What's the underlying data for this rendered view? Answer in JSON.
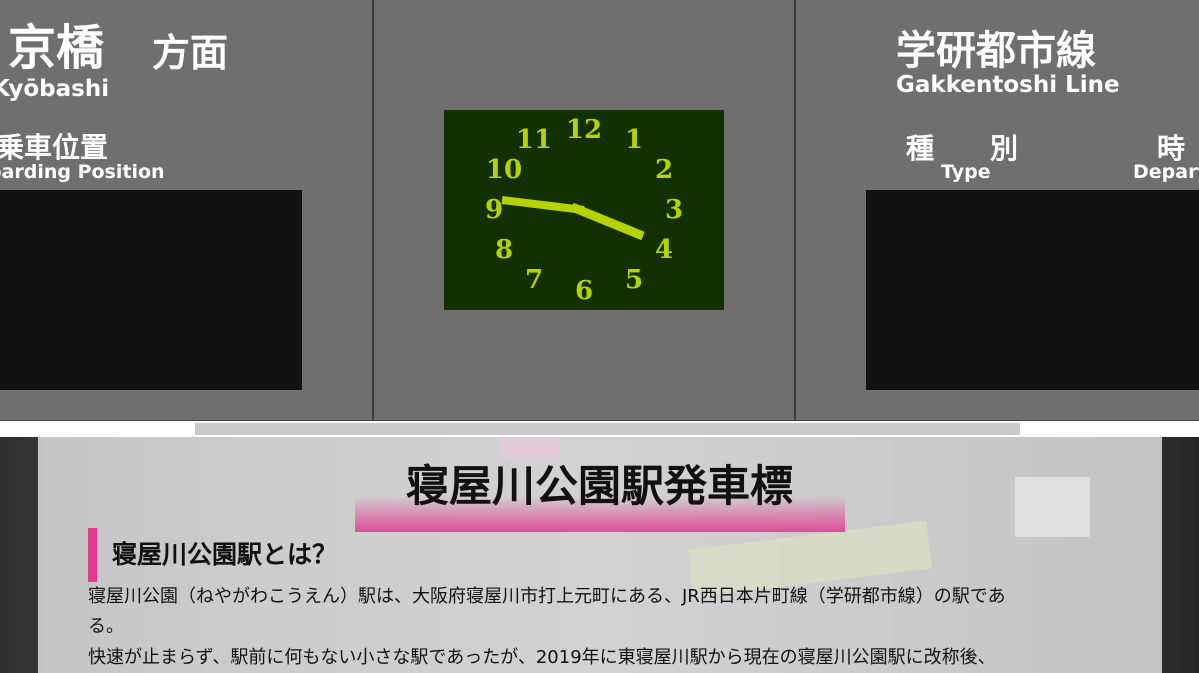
{
  "board": {
    "left": {
      "destination_jp": "京橋",
      "direction_jp": "方面",
      "destination_en": "Kyōbashi",
      "boarding_jp": "乗車位置",
      "boarding_en": "Boarding Position"
    },
    "right": {
      "line_jp": "学研都市線",
      "line_en": "Gakkentoshi Line",
      "type_jp": "種　　別",
      "type_en": "Type",
      "time_jp": "時",
      "time_en": "Depart"
    },
    "clock": {
      "numerals": [
        "12",
        "1",
        "2",
        "3",
        "4",
        "5",
        "6",
        "7",
        "8",
        "9",
        "10",
        "11"
      ],
      "face_color": "#123000",
      "hand_color": "#b5d300",
      "hour": 4,
      "minute": 45
    }
  },
  "article": {
    "title": "寝屋川公園駅発車標",
    "section_heading": "寝屋川公園駅とは？",
    "paragraph_line1": "寝屋川公園（ねやがわこうえん）駅は、大阪府寝屋川市打上元町にある、JR西日本片町線（学研都市線）の駅であ",
    "paragraph_line2": "る。",
    "paragraph_line3": "快速が止まらず、駅前に何もない小さな駅であったが、2019年に東寝屋川駅から現在の寝屋川公園駅に改称後、",
    "accent_color": "#e23b8e"
  }
}
